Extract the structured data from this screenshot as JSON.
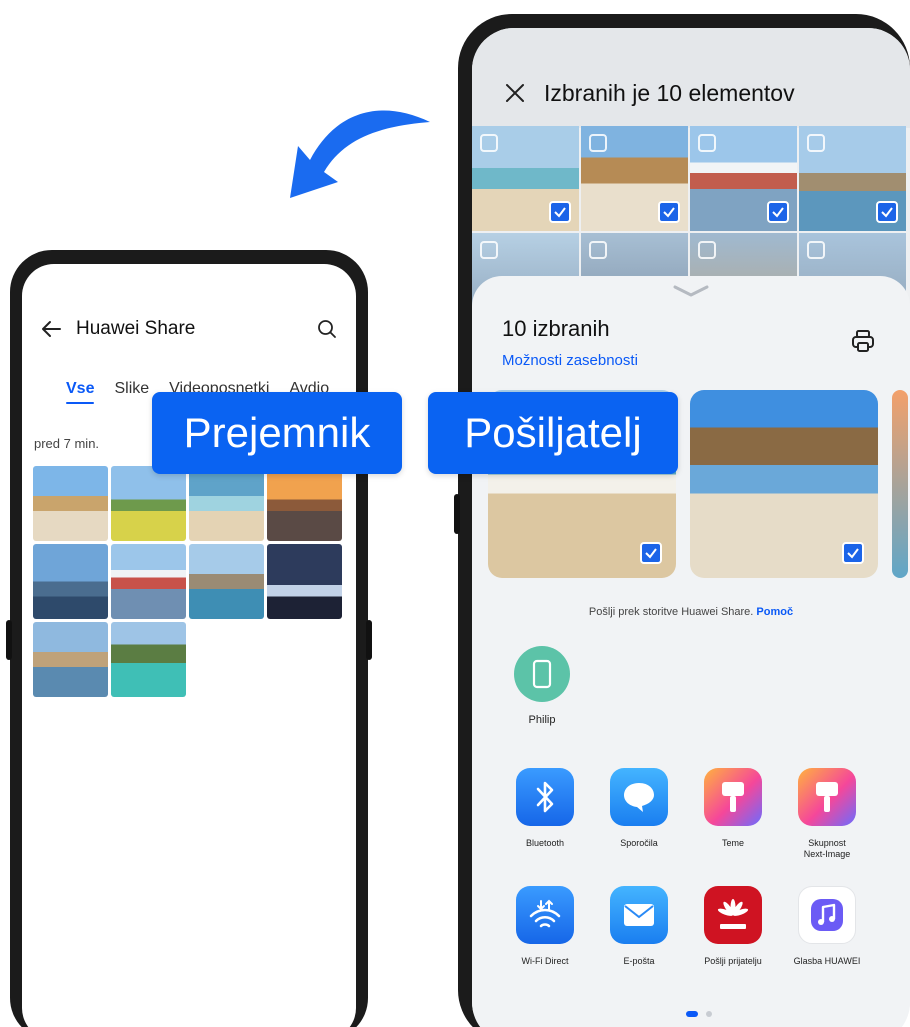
{
  "receiver_label": "Prejemnik",
  "sender_label": "Pošiljatelj",
  "receiver_screen": {
    "title": "Huawei Share",
    "tabs": [
      {
        "label": "Vse",
        "active": true
      },
      {
        "label": "Slike",
        "active": false
      },
      {
        "label": "Videoposnetki",
        "active": false
      },
      {
        "label": "Avdio",
        "active": false
      }
    ],
    "time_group": "pred 7 min."
  },
  "sender_screen": {
    "header_title": "Izbranih je 10 elementov",
    "sheet": {
      "count": "10 izbranih",
      "privacy_link": "Možnosti zasebnosti",
      "share_hint": "Pošlji prek storitve Huawei Share.",
      "help_link": "Pomoč",
      "device_name": "Philip"
    },
    "apps": [
      {
        "label": "Bluetooth",
        "icon": "bluetooth-icon",
        "color": "#1f7cf0"
      },
      {
        "label": "Sporočila",
        "icon": "messages-icon",
        "color": "#1f8af5"
      },
      {
        "label": "Teme",
        "icon": "themes-icon",
        "color": "#f05aa0"
      },
      {
        "label": "Skupnost\nNext-Image",
        "icon": "next-image-icon",
        "color": "#f57a3a"
      },
      {
        "label": "Wi-Fi Direct",
        "icon": "wifi-direct-icon",
        "color": "#1f7cf0"
      },
      {
        "label": "E-pošta",
        "icon": "email-icon",
        "color": "#1f8af5"
      },
      {
        "label": "Pošlji prijatelju",
        "icon": "huawei-icon",
        "color": "#cf1322"
      },
      {
        "label": "Glasba HUAWEI",
        "icon": "music-icon",
        "color": "#6b5bf5"
      }
    ]
  }
}
